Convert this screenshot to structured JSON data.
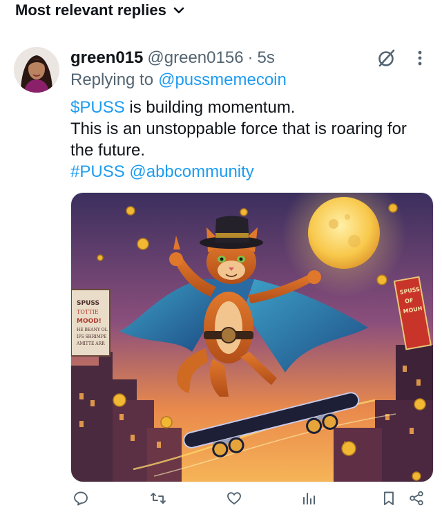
{
  "sort": {
    "label": "Most relevant replies",
    "icon": "chevron-down-icon"
  },
  "reply": {
    "display_name": "green015",
    "handle": "@green0156",
    "separator": "·",
    "time": "5s",
    "replying_to_prefix": "Replying to",
    "replying_to_handle": "@pussmemecoin",
    "text": {
      "cashtag": "$PUSS",
      "line1_rest": " is building momentum.",
      "line2": "This is an unstoppable force that is roaring for",
      "line3": "the future.",
      "hashtag": "#PUSS",
      "mention": "@abbcommunity"
    },
    "media": {
      "left_sign": [
        "SPUSS",
        "TOTTIE",
        "MOOD!",
        "HE BEANY OL",
        "IFS SHRIMPE",
        "AMITTE ARR"
      ],
      "right_sign": [
        "SPUSS",
        "OF",
        "MOUH"
      ]
    }
  },
  "actions": {
    "reply_icon": "reply-icon",
    "repost_icon": "repost-icon",
    "like_icon": "like-icon",
    "views_icon": "views-icon",
    "bookmark_icon": "bookmark-icon",
    "share_icon": "share-icon",
    "grok_icon": "grok-icon",
    "more_icon": "more-icon"
  },
  "colors": {
    "link": "#1d9bf0",
    "secondary": "#536471",
    "primary_text": "#0f1419"
  }
}
